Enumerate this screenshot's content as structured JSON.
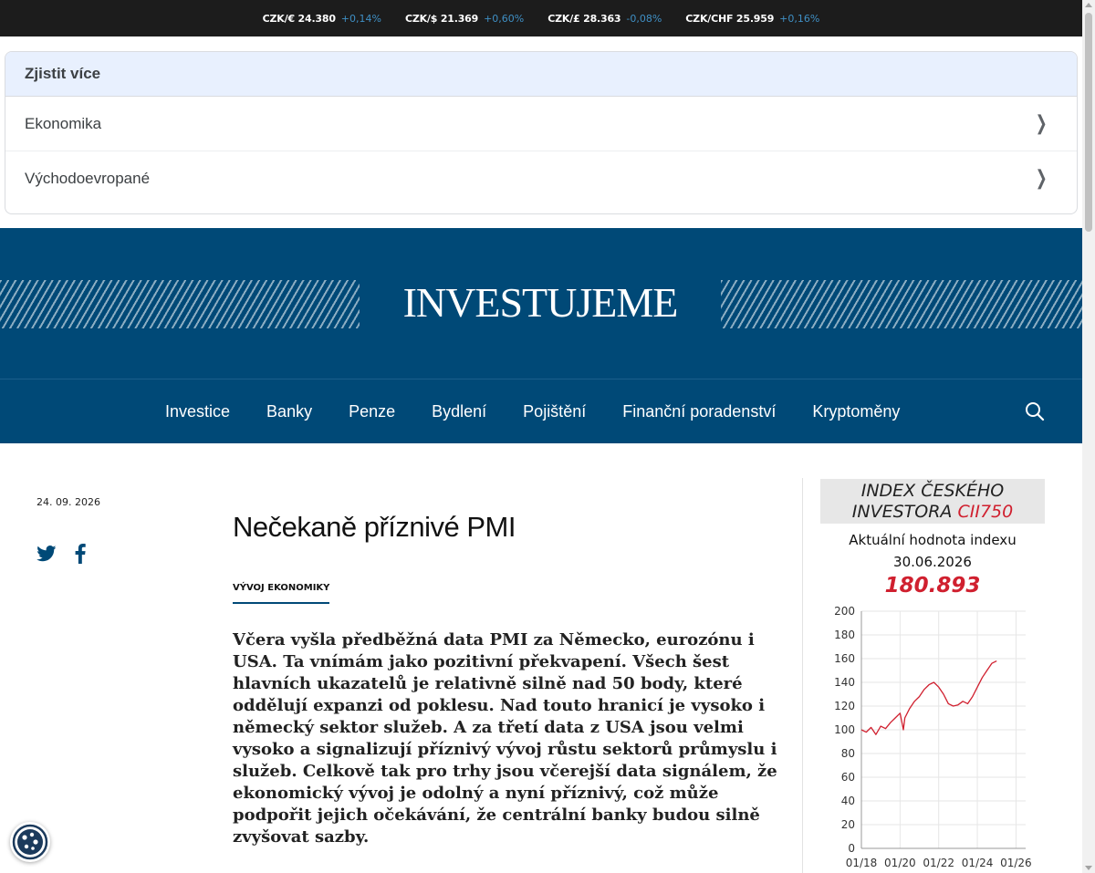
{
  "ticker": [
    {
      "pair": "CZK/€ 24.380",
      "change": "+0,14%"
    },
    {
      "pair": "CZK/$ 21.369",
      "change": "+0,60%"
    },
    {
      "pair": "CZK/£ 28.363",
      "change": "-0,08%"
    },
    {
      "pair": "CZK/CHF 25.959",
      "change": "+0,16%"
    }
  ],
  "learn_more": {
    "heading": "Zjistit více",
    "items": [
      "Ekonomika",
      "Východoevropané"
    ]
  },
  "site": {
    "logo": "INVESTUJEME",
    "nav": [
      "Investice",
      "Banky",
      "Penze",
      "Bydlení",
      "Pojištění",
      "Finanční poradenství",
      "Kryptoměny"
    ]
  },
  "article": {
    "date": "24. 09. 2026",
    "title": "Nečekaně příznivé PMI",
    "category": "VÝVOJ EKONOMIKY",
    "lead": "Včera vyšla předběžná data PMI za Německo, eurozónu i USA. Ta vnímám jako pozitivní překvapení. Všech šest hlavních ukazatelů je relativně silně nad 50 body, které oddělují expanzi od poklesu. Nad touto hranicí je vysoko i německý sektor služeb. A za třetí data z USA jsou velmi vysoko a signalizují příznivý vývoj růstu sektorů průmyslu i služeb. Celkově tak pro trhy jsou včerejší data signálem, že ekonomický vývoj je odolný a nyní příznivý, což může podpořit jejich očekávání, že centrální banky budou silně zvyšovat sazby."
  },
  "index_widget": {
    "title_line1": "INDEX ČESKÉHO",
    "title_line2": "INVESTORA",
    "title_code": "CII750",
    "subtitle": "Aktuální hodnota indexu",
    "date": "30.06.2026",
    "value": "180.893",
    "colors": {
      "accent": "#d0202f",
      "line": "#d0202f"
    }
  },
  "chart_data": {
    "type": "line",
    "title": "",
    "xlabel": "",
    "ylabel": "",
    "ylim": [
      0,
      200
    ],
    "yticks": [
      0,
      20,
      40,
      60,
      80,
      100,
      120,
      140,
      160,
      180,
      200
    ],
    "xtick_labels": [
      "01/18",
      "01/20",
      "01/22",
      "01/24",
      "01/26"
    ],
    "xlim": [
      2018.0,
      2026.5
    ],
    "grid": true,
    "series": [
      {
        "x": [
          2018.0,
          2018.25,
          2018.5,
          2018.75,
          2019.0,
          2019.25,
          2019.5,
          2019.75,
          2020.0,
          2020.17,
          2020.25,
          2020.5,
          2020.75,
          2021.0,
          2021.25,
          2021.5,
          2021.75,
          2022.0,
          2022.25,
          2022.5,
          2022.75,
          2023.0,
          2023.25,
          2023.5,
          2023.75,
          2024.0,
          2024.25,
          2024.5,
          2024.75,
          2025.0
        ],
        "y": [
          100,
          98,
          102,
          96,
          103,
          101,
          106,
          110,
          114,
          100,
          110,
          118,
          124,
          128,
          134,
          138,
          140,
          136,
          130,
          122,
          120,
          121,
          124,
          122,
          128,
          136,
          144,
          150,
          156,
          158
        ]
      }
    ]
  }
}
